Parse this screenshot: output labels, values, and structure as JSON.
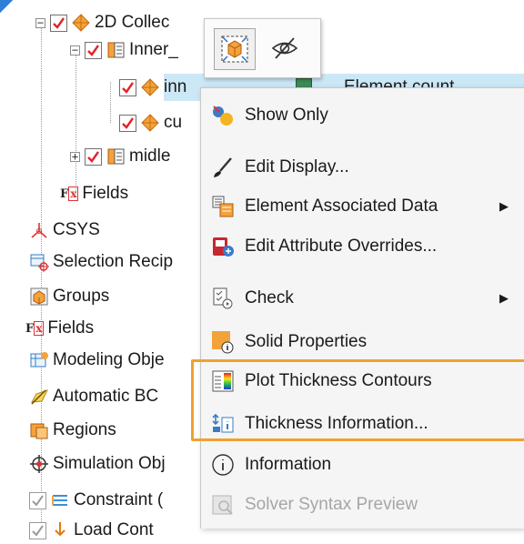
{
  "tree": {
    "items": [
      {
        "label": "2D Collec",
        "icon": "mesh-collector-icon",
        "expander": "−",
        "checked": true
      },
      {
        "label": "Inner_",
        "icon": "mesh-group-icon",
        "expander": "−",
        "checked": true
      },
      {
        "label": "inn",
        "icon": "mesh-icon",
        "checked": true
      },
      {
        "label": "cu",
        "icon": "mesh-icon",
        "checked": true
      },
      {
        "label": "midle",
        "icon": "mesh-group-icon",
        "expander": "+",
        "checked": true
      },
      {
        "label": "Fields",
        "icon": "fields-icon"
      },
      {
        "label": "CSYS",
        "icon": "csys-icon"
      },
      {
        "label": "Selection Recip",
        "icon": "selection-recipe-icon"
      },
      {
        "label": "Groups",
        "icon": "groups-icon"
      },
      {
        "label": "Fields",
        "icon": "fields-icon"
      },
      {
        "label": "Modeling Obje",
        "icon": "modeling-objects-icon"
      },
      {
        "label": "Automatic BC",
        "icon": "automatic-bc-icon"
      },
      {
        "label": "Regions",
        "icon": "regions-icon"
      },
      {
        "label": "Simulation Obj",
        "icon": "simulation-objects-icon"
      },
      {
        "label": "Constraint (",
        "icon": "constraint-icon",
        "checked": true
      },
      {
        "label": "Load Cont",
        "icon": "load-container-icon",
        "checked": true
      }
    ],
    "selected_row_text": "Element count"
  },
  "mini_toolbar": {
    "buttons": [
      {
        "name": "fit-view-icon",
        "active": true
      },
      {
        "name": "hide-icon",
        "active": false
      }
    ]
  },
  "context_menu": {
    "items": [
      {
        "label": "Show Only",
        "icon": "show-only-icon"
      },
      {
        "label": "Edit Display...",
        "icon": "edit-display-brush-icon"
      },
      {
        "label": "Element Associated Data",
        "icon": "element-associated-data-icon",
        "submenu": true
      },
      {
        "label": "Edit Attribute Overrides...",
        "icon": "edit-attribute-overrides-icon"
      },
      {
        "label": "Check",
        "icon": "check-icon",
        "submenu": true
      },
      {
        "label": "Solid Properties",
        "icon": "solid-properties-icon"
      },
      {
        "label": "Plot Thickness Contours",
        "icon": "plot-thickness-contours-icon"
      },
      {
        "label": "Thickness Information...",
        "icon": "thickness-information-icon"
      },
      {
        "label": "Information",
        "icon": "information-icon"
      },
      {
        "label": "Solver Syntax Preview",
        "icon": "solver-syntax-preview-icon",
        "disabled": true
      }
    ],
    "submenu_arrow": "▶"
  },
  "colors": {
    "highlight_border": "#f0a030",
    "check_red": "#e0242a",
    "selection_bg": "#cce8f7",
    "menu_bg": "#f5f5f5"
  }
}
